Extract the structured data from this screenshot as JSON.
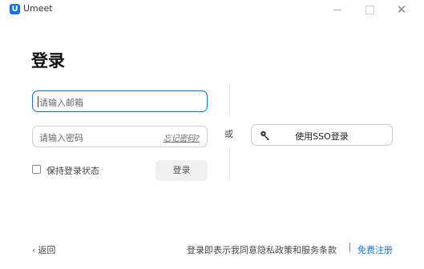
{
  "window": {
    "title": "Umeet",
    "logo_letter": "U",
    "controls": {
      "minimize": "minimize-icon",
      "maximize": "maximize-icon",
      "close": "close-icon"
    },
    "accent": "#0e72ed"
  },
  "page": {
    "title": "登录"
  },
  "form": {
    "email_placeholder": "请输入邮箱",
    "email_value": "",
    "password_placeholder": "请输入密码",
    "password_value": "",
    "forgot_label": "忘记密码?",
    "remember_label": "保持登录状态",
    "remember_checked": false,
    "login_label": "登录"
  },
  "alt": {
    "or_label": "或",
    "sso_label": "使用SSO登录",
    "sso_icon": "key-icon"
  },
  "footer": {
    "back_label": "返回",
    "terms_text": "登录即表示我同意隐私政策和服务条款",
    "signup_label": "免费注册"
  }
}
